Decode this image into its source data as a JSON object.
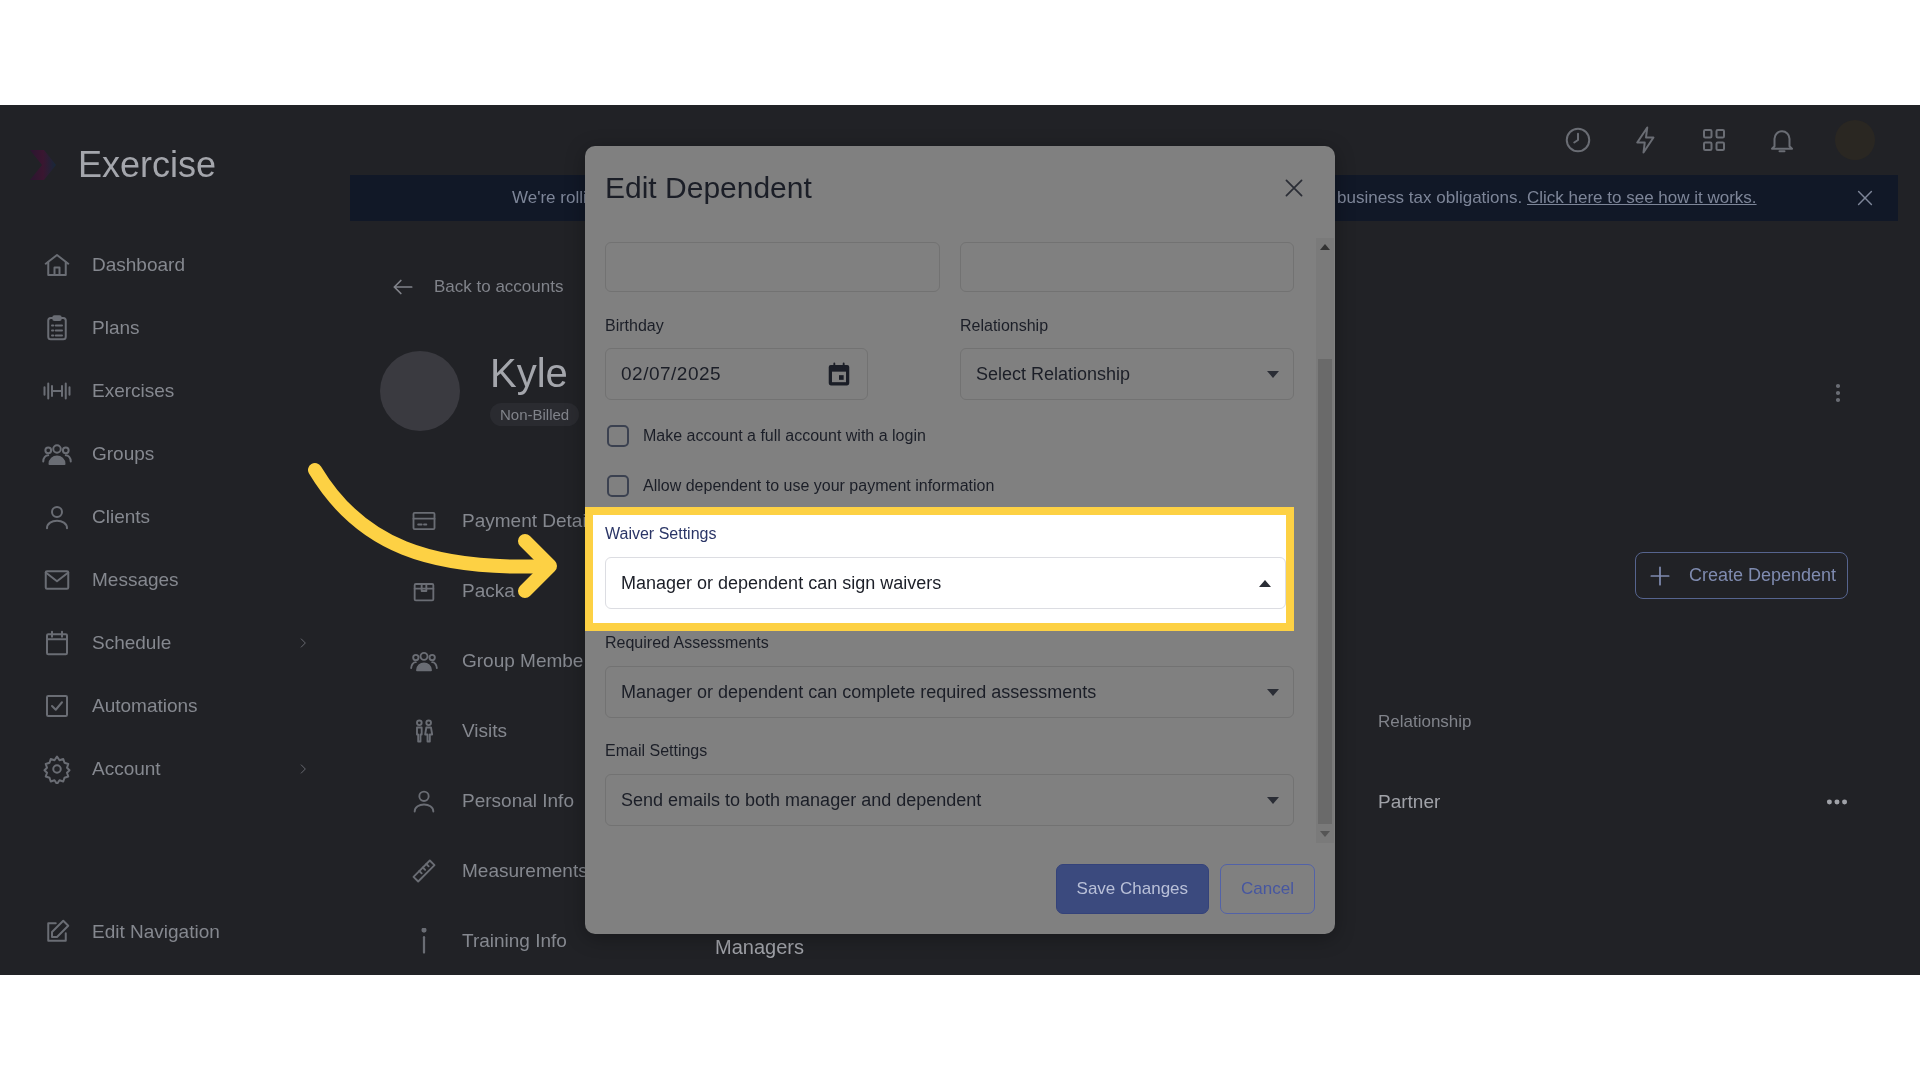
{
  "sidebar": {
    "logo": "Exercise",
    "items": [
      {
        "label": "Dashboard",
        "expandable": false
      },
      {
        "label": "Plans",
        "expandable": false
      },
      {
        "label": "Exercises",
        "expandable": false
      },
      {
        "label": "Groups",
        "expandable": false
      },
      {
        "label": "Clients",
        "expandable": false
      },
      {
        "label": "Messages",
        "expandable": false
      },
      {
        "label": "Schedule",
        "expandable": true
      },
      {
        "label": "Automations",
        "expandable": false
      },
      {
        "label": "Account",
        "expandable": true
      }
    ],
    "footer": "Edit Navigation"
  },
  "banner": {
    "text_left": "We're rolli",
    "text_right": "business tax obligations.",
    "link": "Click here to see how it works."
  },
  "account": {
    "back": "Back to accounts",
    "name": "Kyle",
    "badge": "Non-Billed",
    "sections": [
      "Payment Detai",
      "Packa",
      "Group Membe",
      "Visits",
      "Personal Info",
      "Measurements",
      "Training Info"
    ],
    "create_button": "Create Dependent",
    "table": {
      "column": "Relationship",
      "row": "Partner"
    },
    "managers": "Managers"
  },
  "modal": {
    "title": "Edit Dependent",
    "top_fields": [
      {
        "kind": "text"
      },
      {
        "kind": "text"
      }
    ],
    "birthday": {
      "label": "Birthday",
      "value": "02/07/2025"
    },
    "relationship": {
      "label": "Relationship",
      "placeholder": "Select Relationship",
      "expanded": false
    },
    "checkboxes": [
      {
        "label": "Make account a full account with a login",
        "checked": false
      },
      {
        "label": "Allow dependent to use your payment information",
        "checked": false
      }
    ],
    "selects": [
      {
        "label": "Waiver Settings",
        "value": "Manager or dependent can sign waivers",
        "expanded": true,
        "highlighted": true
      },
      {
        "label": "Required Assessments",
        "value": "Manager or dependent can complete required assessments",
        "expanded": false,
        "highlighted": false
      },
      {
        "label": "Email Settings",
        "value": "Send emails to both manager and dependent",
        "expanded": false,
        "highlighted": false
      }
    ],
    "buttons": [
      {
        "label": "Save Changes",
        "kind": "primary"
      },
      {
        "label": "Cancel",
        "kind": "secondary"
      }
    ]
  }
}
